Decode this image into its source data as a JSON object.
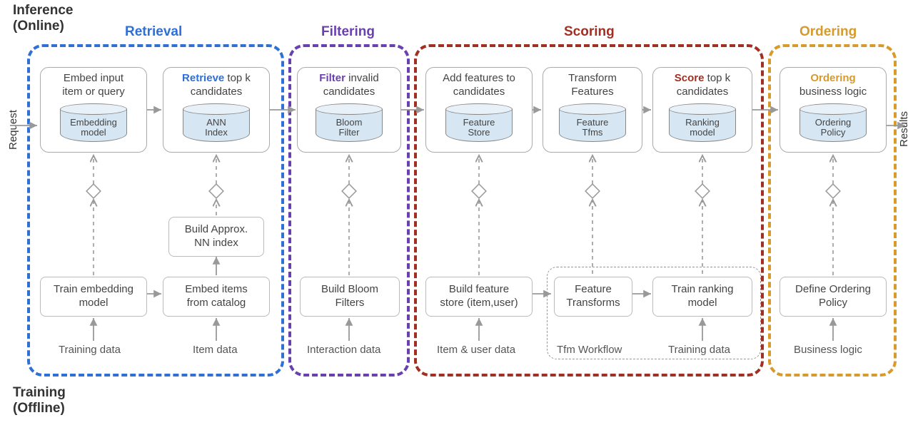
{
  "headers": {
    "inference": "Inference\n(Online)",
    "training": "Training\n(Offline)"
  },
  "io": {
    "request": "Request",
    "results": "Results"
  },
  "stages": {
    "retrieval": {
      "title": "Retrieval",
      "color": "#2f6fd6"
    },
    "filtering": {
      "title": "Filtering",
      "color": "#6a3fb0"
    },
    "scoring": {
      "title": "Scoring",
      "color": "#a12f22"
    },
    "ordering": {
      "title": "Ordering",
      "color": "#d79a2b"
    }
  },
  "nodes": {
    "embed": {
      "line1": "Embed input",
      "line2": "item or query",
      "cyl": "Embedding\nmodel"
    },
    "retrieve": {
      "kw": "Retrieve",
      "rest1": " top k",
      "line2": "candidates",
      "cyl": "ANN\nIndex"
    },
    "filter": {
      "kw": "Filter",
      "rest1": " invalid",
      "line2": "candidates",
      "cyl": "Bloom\nFilter"
    },
    "addfeat": {
      "line1": "Add features to",
      "line2": "candidates",
      "cyl": "Feature\nStore"
    },
    "tfms": {
      "line1": "Transform",
      "line2": "Features",
      "cyl": "Feature\nTfms"
    },
    "score": {
      "kw": "Score",
      "rest1": " top k",
      "line2": "candidates",
      "cyl": "Ranking\nmodel"
    },
    "ordering": {
      "kw": "Ordering",
      "line2": "business logic",
      "cyl": "Ordering\nPolicy"
    }
  },
  "training_nodes": {
    "train_emb": "Train embedding\nmodel",
    "build_ann": "Build Approx.\nNN index",
    "embed_items": "Embed items\nfrom catalog",
    "bloom": "Build Bloom\nFilters",
    "feat_store": "Build feature\nstore (item,user)",
    "feat_tfms": "Feature\nTransforms",
    "train_rank": "Train ranking\nmodel",
    "def_policy": "Define Ordering\nPolicy"
  },
  "data_sources": {
    "training_data_l": "Training data",
    "item_data": "Item data",
    "interaction": "Interaction data",
    "item_user": "Item & user data",
    "tfm_workflow": "Tfm Workflow",
    "training_data_r": "Training data",
    "biz_logic": "Business logic"
  },
  "colors": {
    "retrieval_kw": "#2f6fd6",
    "filtering_kw": "#6a3fb0",
    "scoring_kw": "#a12f22",
    "ordering_kw": "#d79a2b"
  }
}
